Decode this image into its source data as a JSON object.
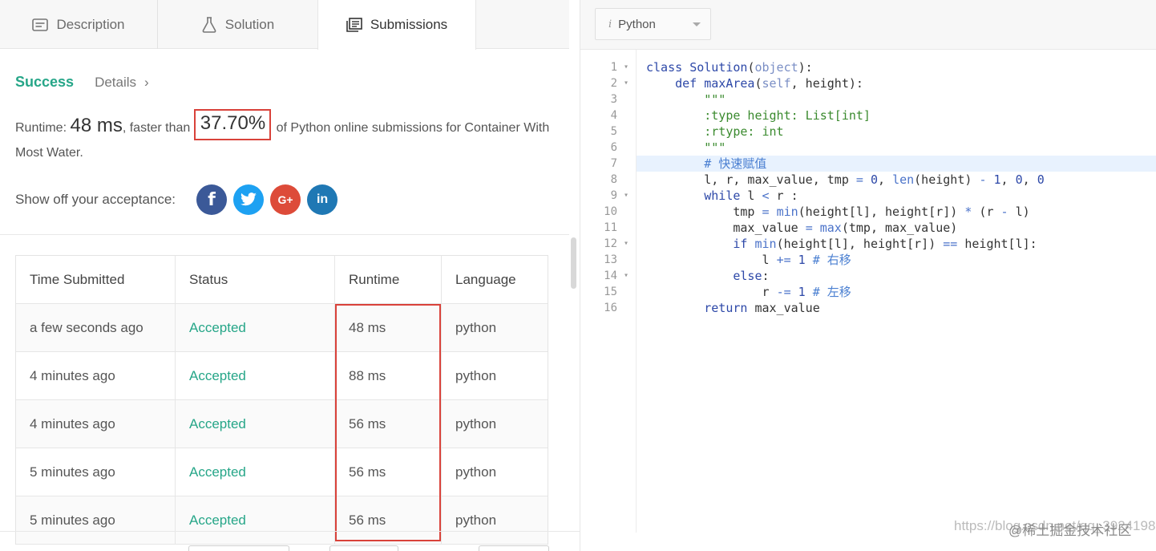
{
  "tabs": {
    "description": "Description",
    "solution": "Solution",
    "submissions": "Submissions"
  },
  "result": {
    "status": "Success",
    "details": "Details",
    "chevron": "›"
  },
  "runtime": {
    "prefix": "Runtime: ",
    "time": "48 ms",
    "faster": ", faster than ",
    "percent": "37.70%",
    "suffix": " of Python online submissions for Container With Most Water."
  },
  "share": {
    "label": "Show off your acceptance:",
    "facebook": "f",
    "google": "G+",
    "linkedin": "in"
  },
  "table": {
    "headers": [
      "Time Submitted",
      "Status",
      "Runtime",
      "Language"
    ],
    "rows": [
      {
        "time": "a few seconds ago",
        "status": "Accepted",
        "runtime": "48 ms",
        "language": "python"
      },
      {
        "time": "4 minutes ago",
        "status": "Accepted",
        "runtime": "88 ms",
        "language": "python"
      },
      {
        "time": "4 minutes ago",
        "status": "Accepted",
        "runtime": "56 ms",
        "language": "python"
      },
      {
        "time": "5 minutes ago",
        "status": "Accepted",
        "runtime": "56 ms",
        "language": "python"
      },
      {
        "time": "5 minutes ago",
        "status": "Accepted",
        "runtime": "56 ms",
        "language": "python"
      }
    ]
  },
  "editor": {
    "language_icon": "i",
    "language": "Python",
    "line_numbers": [
      "1",
      "2",
      "3",
      "4",
      "5",
      "6",
      "7",
      "8",
      "9",
      "10",
      "11",
      "12",
      "13",
      "14",
      "15",
      "16"
    ]
  },
  "watermark": {
    "url": "https://blog.csdn.net/qq_39241986",
    "brand": "@稀土掘金技术社区"
  },
  "colors": {
    "accent_green": "#26a688",
    "highlight_red": "#d9423a",
    "facebook": "#3b5998",
    "twitter": "#1da1f2",
    "google": "#dd4b39",
    "linkedin": "#1f78b4"
  }
}
